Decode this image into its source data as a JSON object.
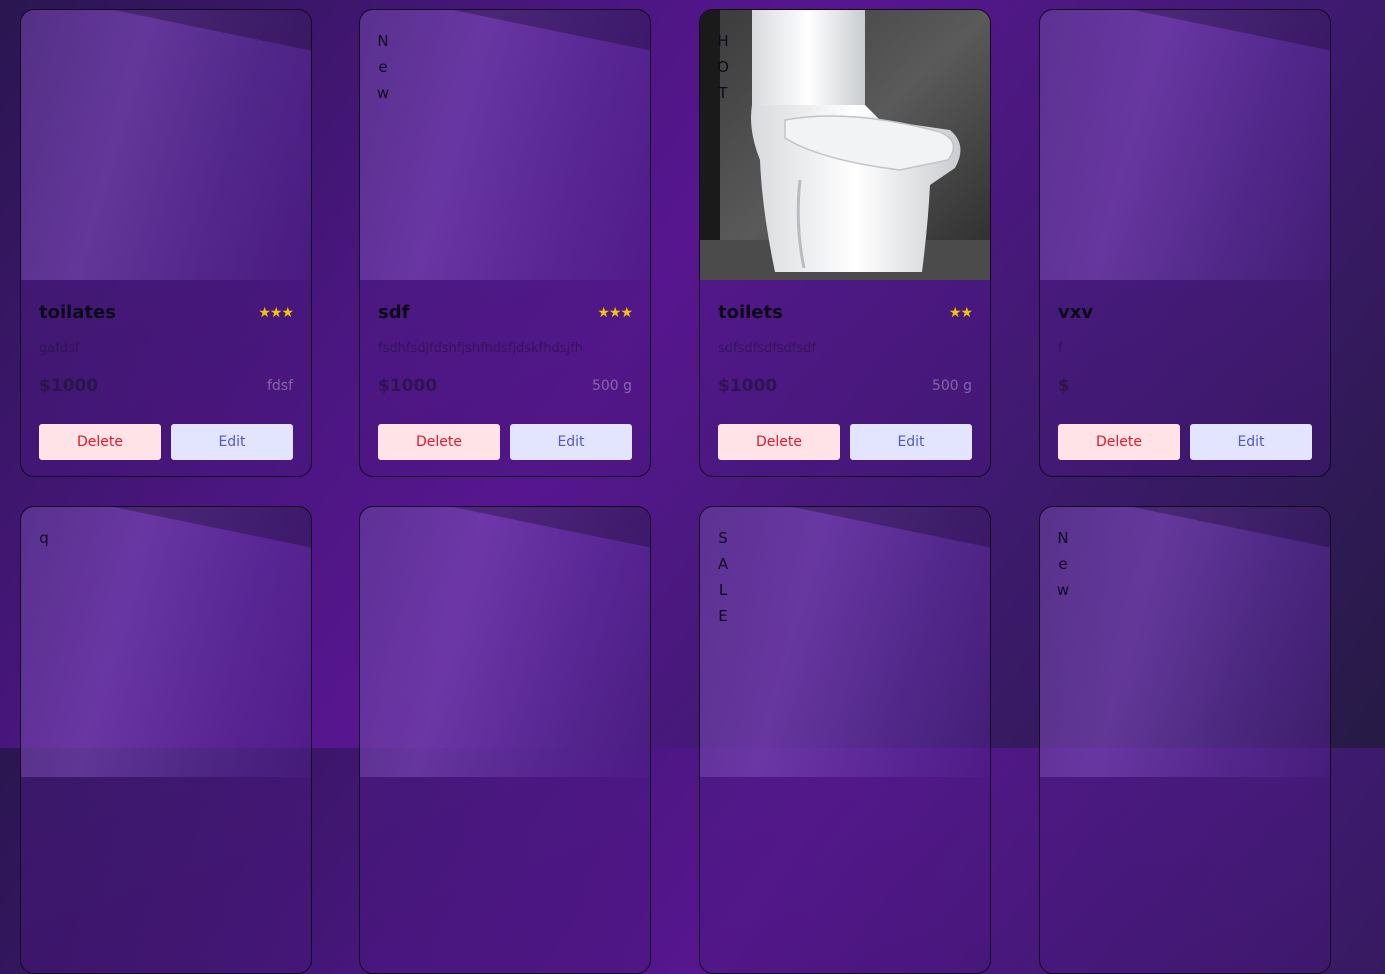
{
  "colors": {
    "background_start": "#2a1650",
    "background_mid": "#57168f",
    "star": "#f5c400",
    "delete_bg": "#ffe3e6",
    "delete_text": "#e2182b",
    "edit_bg": "#e3e5ff",
    "edit_text": "#5657c7"
  },
  "products": [
    {
      "tag": "",
      "title": "toilates",
      "stars": "★★★",
      "description": "gafdsf",
      "price": "$1000",
      "weight": "fdsf",
      "delete_label": "Delete",
      "edit_label": "Edit",
      "has_photo": false
    },
    {
      "tag": "New",
      "title": "sdf",
      "stars": "★★★",
      "description": "fsdhfsdjfdshfjshfhdsfjdskfhdsjfh",
      "price": "$1000",
      "weight": "500 g",
      "delete_label": "Delete",
      "edit_label": "Edit",
      "has_photo": false
    },
    {
      "tag": "HOT",
      "title": "toilets",
      "stars": "★★",
      "description": "sdfsdfsdfsdfsdf",
      "price": "$1000",
      "weight": "500 g",
      "delete_label": "Delete",
      "edit_label": "Edit",
      "has_photo": true
    },
    {
      "tag": "",
      "title": "vxv",
      "stars": "",
      "description": "f",
      "price": "$",
      "weight": "",
      "delete_label": "Delete",
      "edit_label": "Edit",
      "has_photo": false
    },
    {
      "tag": "q",
      "has_photo": false
    },
    {
      "tag": "",
      "has_photo": false
    },
    {
      "tag": "SALE",
      "has_photo": false
    },
    {
      "tag": "New",
      "has_photo": false
    }
  ]
}
